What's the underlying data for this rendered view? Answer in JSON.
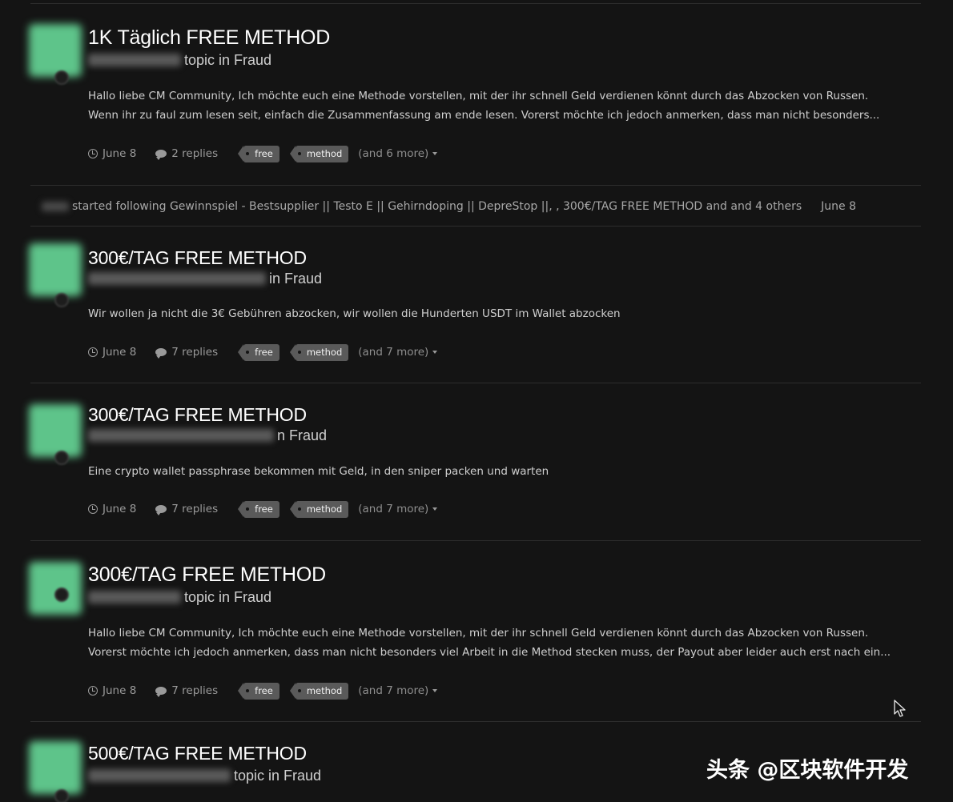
{
  "posts": [
    {
      "title": "1K Täglich FREE METHOD",
      "byline": "topic in Fraud",
      "excerpt": [
        "Hallo liebe CM Community, Ich möchte euch eine Methode vorstellen, mit der ihr schnell Geld verdienen könnt durch das Abzocken von Russen.",
        "Wenn ihr zu faul zum lesen seit, einfach die Zusammenfassung am ende lesen. Vorerst möchte ich jedoch anmerken, dass man nicht besonders..."
      ],
      "date": "June 8",
      "replies": "2 replies",
      "tags": [
        "free",
        "method"
      ],
      "more": "(and 6 more)"
    },
    {
      "title": "300€/TAG FREE METHOD",
      "byline": "in Fraud",
      "excerpt": [
        "Wir wollen ja nicht die 3€ Gebühren abzocken, wir wollen die Hunderten USDT im Wallet abzocken"
      ],
      "date": "June 8",
      "replies": "7 replies",
      "tags": [
        "free",
        "method"
      ],
      "more": "(and 7 more)"
    },
    {
      "title": "300€/TAG FREE METHOD",
      "byline": "n Fraud",
      "excerpt": [
        "Eine crypto wallet passphrase bekommen mit Geld, in den sniper packen und warten"
      ],
      "date": "June 8",
      "replies": "7 replies",
      "tags": [
        "free",
        "method"
      ],
      "more": "(and 7 more)"
    },
    {
      "title": "300€/TAG FREE METHOD",
      "byline": "topic in Fraud",
      "excerpt": [
        "Hallo liebe CM Community, Ich möchte euch eine Methode vorstellen, mit der ihr schnell Geld verdienen könnt durch das Abzocken von Russen.",
        "Vorerst möchte ich jedoch anmerken, dass man nicht besonders viel Arbeit in die Method stecken muss, der Payout aber leider auch erst nach ein..."
      ],
      "date": "June 8",
      "replies": "7 replies",
      "tags": [
        "free",
        "method"
      ],
      "more": "(and 7 more)"
    },
    {
      "title": "500€/TAG FREE METHOD",
      "byline": "topic in Fraud"
    }
  ],
  "activity": {
    "text": "started following Gewinnspiel - Bestsupplier || Testo E || Gehirndoping || DepreStop ||, , 300€/TAG FREE METHOD and and 4 others",
    "date": "June 8"
  },
  "watermark": "头条 @区块软件开发",
  "icons": {
    "date": "clock-icon",
    "replies": "comment-icon",
    "tag": "tag-icon",
    "expand": "caret-down-icon",
    "pointer": "mouse-cursor-icon"
  },
  "colors": {
    "background": "#141414",
    "avatar": "#5ec48a",
    "tag": "#5a5a5a"
  }
}
